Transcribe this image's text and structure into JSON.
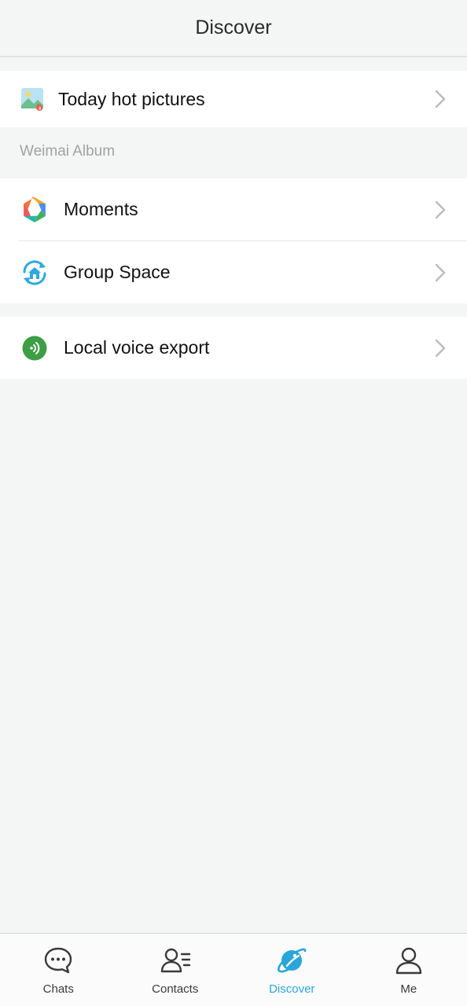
{
  "header": {
    "title": "Discover"
  },
  "hot": {
    "label": "Today hot pictures",
    "icon": "hot-pictures-icon"
  },
  "album_section": {
    "label": "Weimai Album"
  },
  "album_items": [
    {
      "label": "Moments",
      "icon": "moments-aperture-icon"
    },
    {
      "label": "Group Space",
      "icon": "group-space-home-icon"
    }
  ],
  "voice": {
    "label": "Local voice export",
    "icon": "voice-export-icon"
  },
  "tabbar": {
    "tabs": [
      {
        "label": "Chats",
        "icon": "chat-bubble-icon"
      },
      {
        "label": "Contacts",
        "icon": "contacts-icon"
      },
      {
        "label": "Discover",
        "icon": "planet-icon",
        "active": true
      },
      {
        "label": "Me",
        "icon": "person-icon"
      }
    ]
  },
  "colors": {
    "accent": "#2aa6d8",
    "voice_green": "#3d9e45",
    "background": "#f4f5f5"
  }
}
